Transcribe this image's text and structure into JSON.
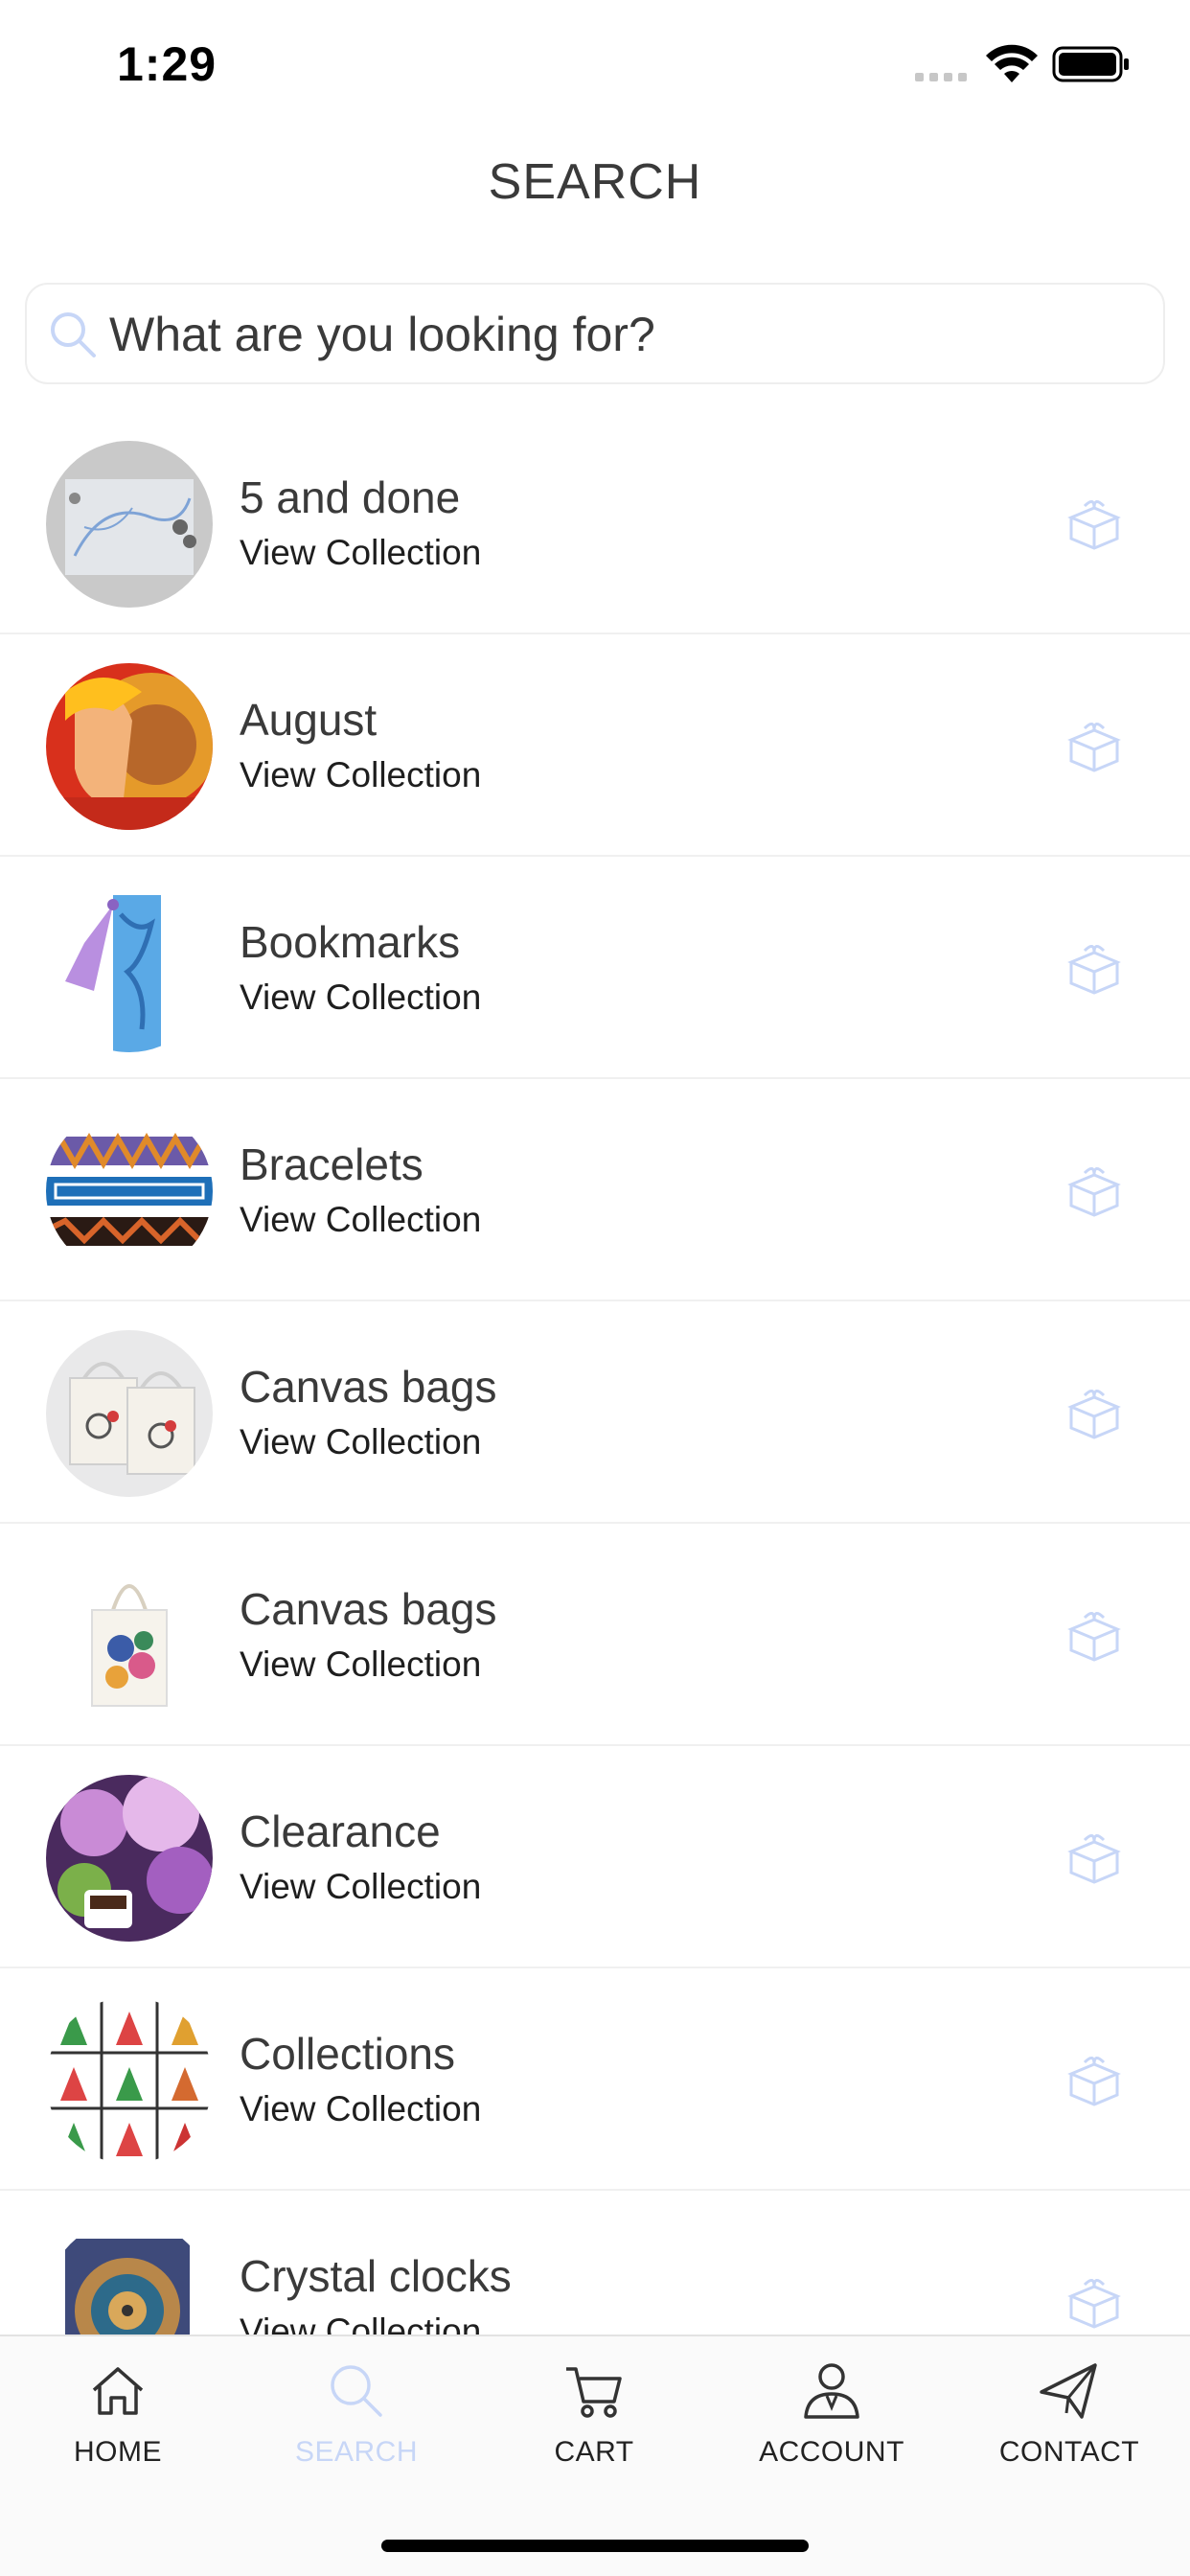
{
  "status_bar": {
    "time": "1:29"
  },
  "header": {
    "title": "SEARCH"
  },
  "search": {
    "placeholder": "What are you looking for?"
  },
  "collections": [
    {
      "title": "5 and done",
      "subtitle": "View Collection",
      "thumb": "cat-sketch"
    },
    {
      "title": "August",
      "subtitle": "View Collection",
      "thumb": "lion-woman"
    },
    {
      "title": "Bookmarks",
      "subtitle": "View Collection",
      "thumb": "bookmark-tassel"
    },
    {
      "title": "Bracelets",
      "subtitle": "View Collection",
      "thumb": "bracelets"
    },
    {
      "title": "Canvas bags",
      "subtitle": "View Collection",
      "thumb": "canvas-bags-pair"
    },
    {
      "title": "Canvas bags",
      "subtitle": "View Collection",
      "thumb": "tote-bag"
    },
    {
      "title": "Clearance",
      "subtitle": "View Collection",
      "thumb": "lilac-flowers"
    },
    {
      "title": "Collections",
      "subtitle": "View Collection",
      "thumb": "gnome-grid"
    },
    {
      "title": "Crystal clocks",
      "subtitle": "View Collection",
      "thumb": "mandala-clock"
    }
  ],
  "tab_bar": {
    "home": "HOME",
    "search": "SEARCH",
    "cart": "CART",
    "account": "ACCOUNT",
    "contact": "CONTACT"
  },
  "colors": {
    "accent": "#c7d6f7",
    "text": "#3a3a3a",
    "divider": "#f0f0f0"
  }
}
